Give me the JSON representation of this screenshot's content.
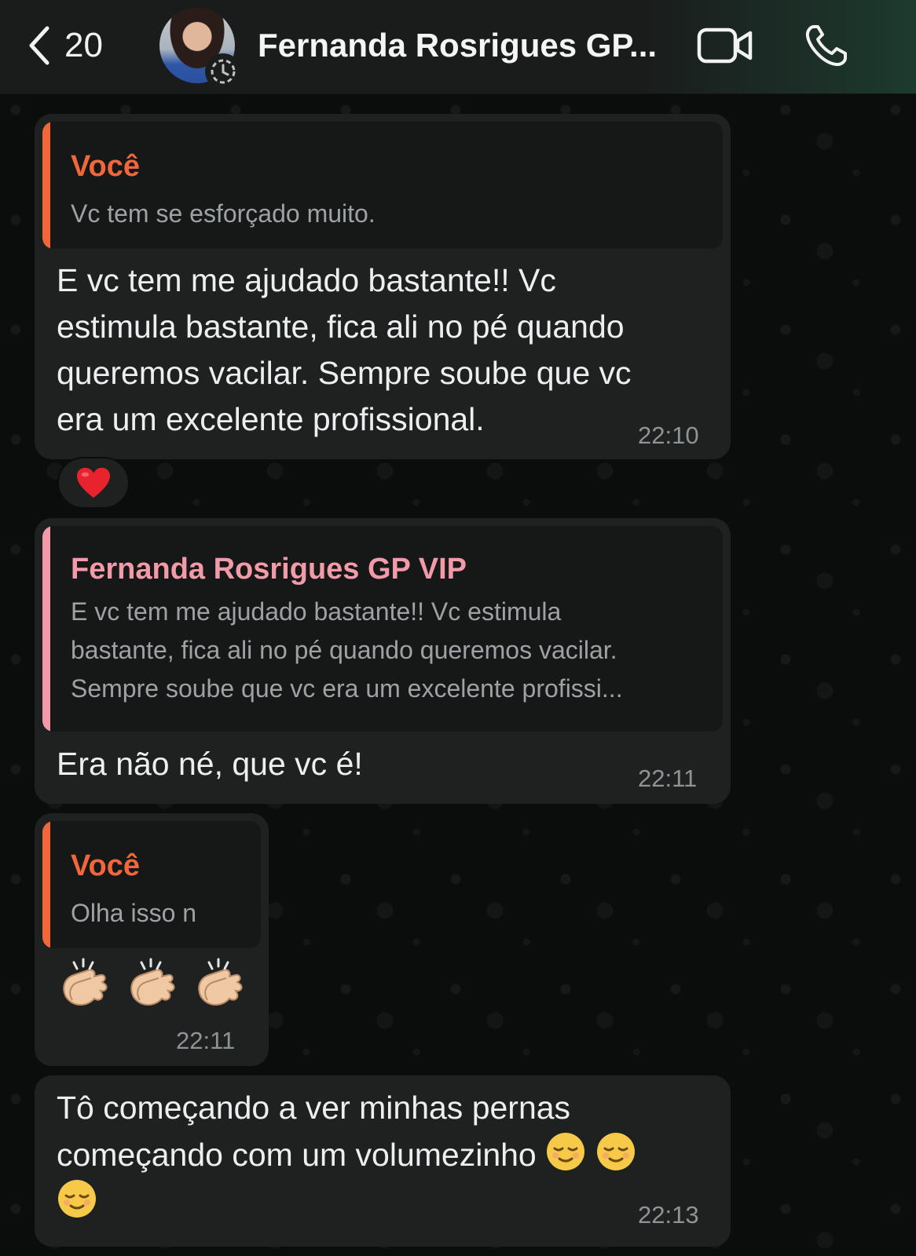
{
  "header": {
    "back_count": "20",
    "contact_name": "Fernanda Rosrigues GP...",
    "icons": [
      "chevron-left-icon",
      "status-icon",
      "video-call-icon",
      "phone-icon"
    ]
  },
  "colors": {
    "you_accent": "#f0683a",
    "contact_accent": "#f29aa8",
    "bubble": "#1f2121",
    "quote_bg": "#161818"
  },
  "messages": [
    {
      "quote_author": "Você",
      "quote_text": "Vc tem se esforçado muito.",
      "lines": [
        "E vc tem me ajudado bastante!! Vc",
        "estimula bastante, fica ali no pé quando",
        "queremos vacilar. Sempre soube que vc",
        "era um excelente profissional."
      ],
      "time": "22:10",
      "reaction": "❤️"
    },
    {
      "quote_author": "Fernanda Rosrigues GP VIP",
      "quote_lines": [
        "E vc tem me ajudado bastante!! Vc estimula",
        "bastante, fica ali no pé quando queremos vacilar.",
        "Sempre soube que vc era um excelente profissi..."
      ],
      "text": "Era não né, que vc é!",
      "time": "22:11"
    },
    {
      "quote_author": "Você",
      "quote_text": "Olha isso n",
      "emojis": "👏🏼👏🏼👏🏼",
      "time": "22:11"
    },
    {
      "lines": [
        "Tô começando a ver minhas pernas",
        "começando com um volumezinho"
      ],
      "emojis": "😌😌😌",
      "time": "22:13"
    }
  ]
}
